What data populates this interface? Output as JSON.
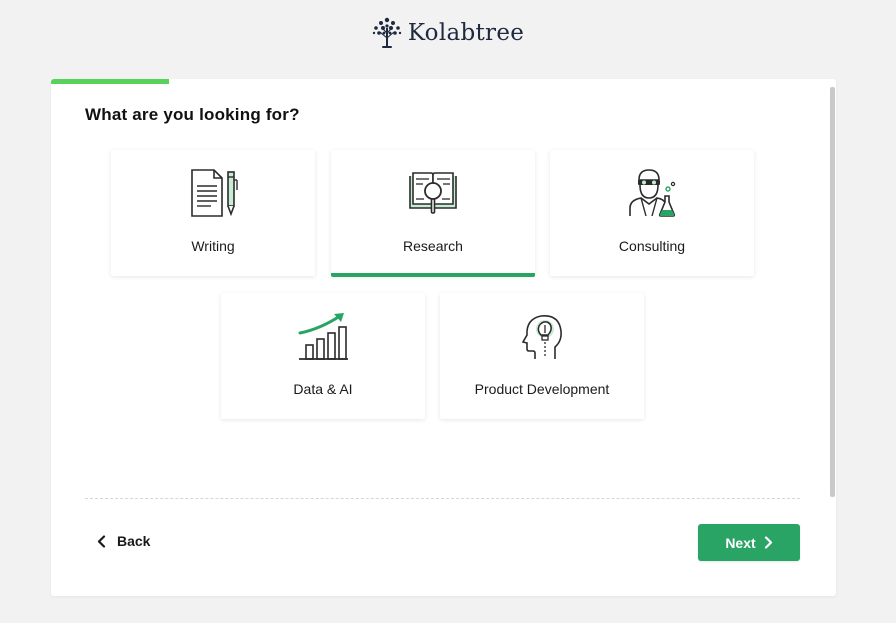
{
  "brand": {
    "name": "Kolabtree",
    "logo_icon": "tree-logo-icon"
  },
  "wizard": {
    "progress_fraction": 0.15,
    "title": "What are you looking for?",
    "options": [
      {
        "label": "Writing",
        "icon": "document-pen-icon",
        "selected": false
      },
      {
        "label": "Research",
        "icon": "book-magnifier-icon",
        "selected": true
      },
      {
        "label": "Consulting",
        "icon": "scientist-icon",
        "selected": false
      },
      {
        "label": "Data & AI",
        "icon": "growth-chart-icon",
        "selected": false
      },
      {
        "label": "Product Development",
        "icon": "idea-head-icon",
        "selected": false
      }
    ],
    "back_label": "Back",
    "next_label": "Next"
  },
  "colors": {
    "accent": "#2aa464",
    "progress": "#58d25b",
    "brand_text": "#1f2940",
    "icon_fill": "#c8ecd3"
  }
}
